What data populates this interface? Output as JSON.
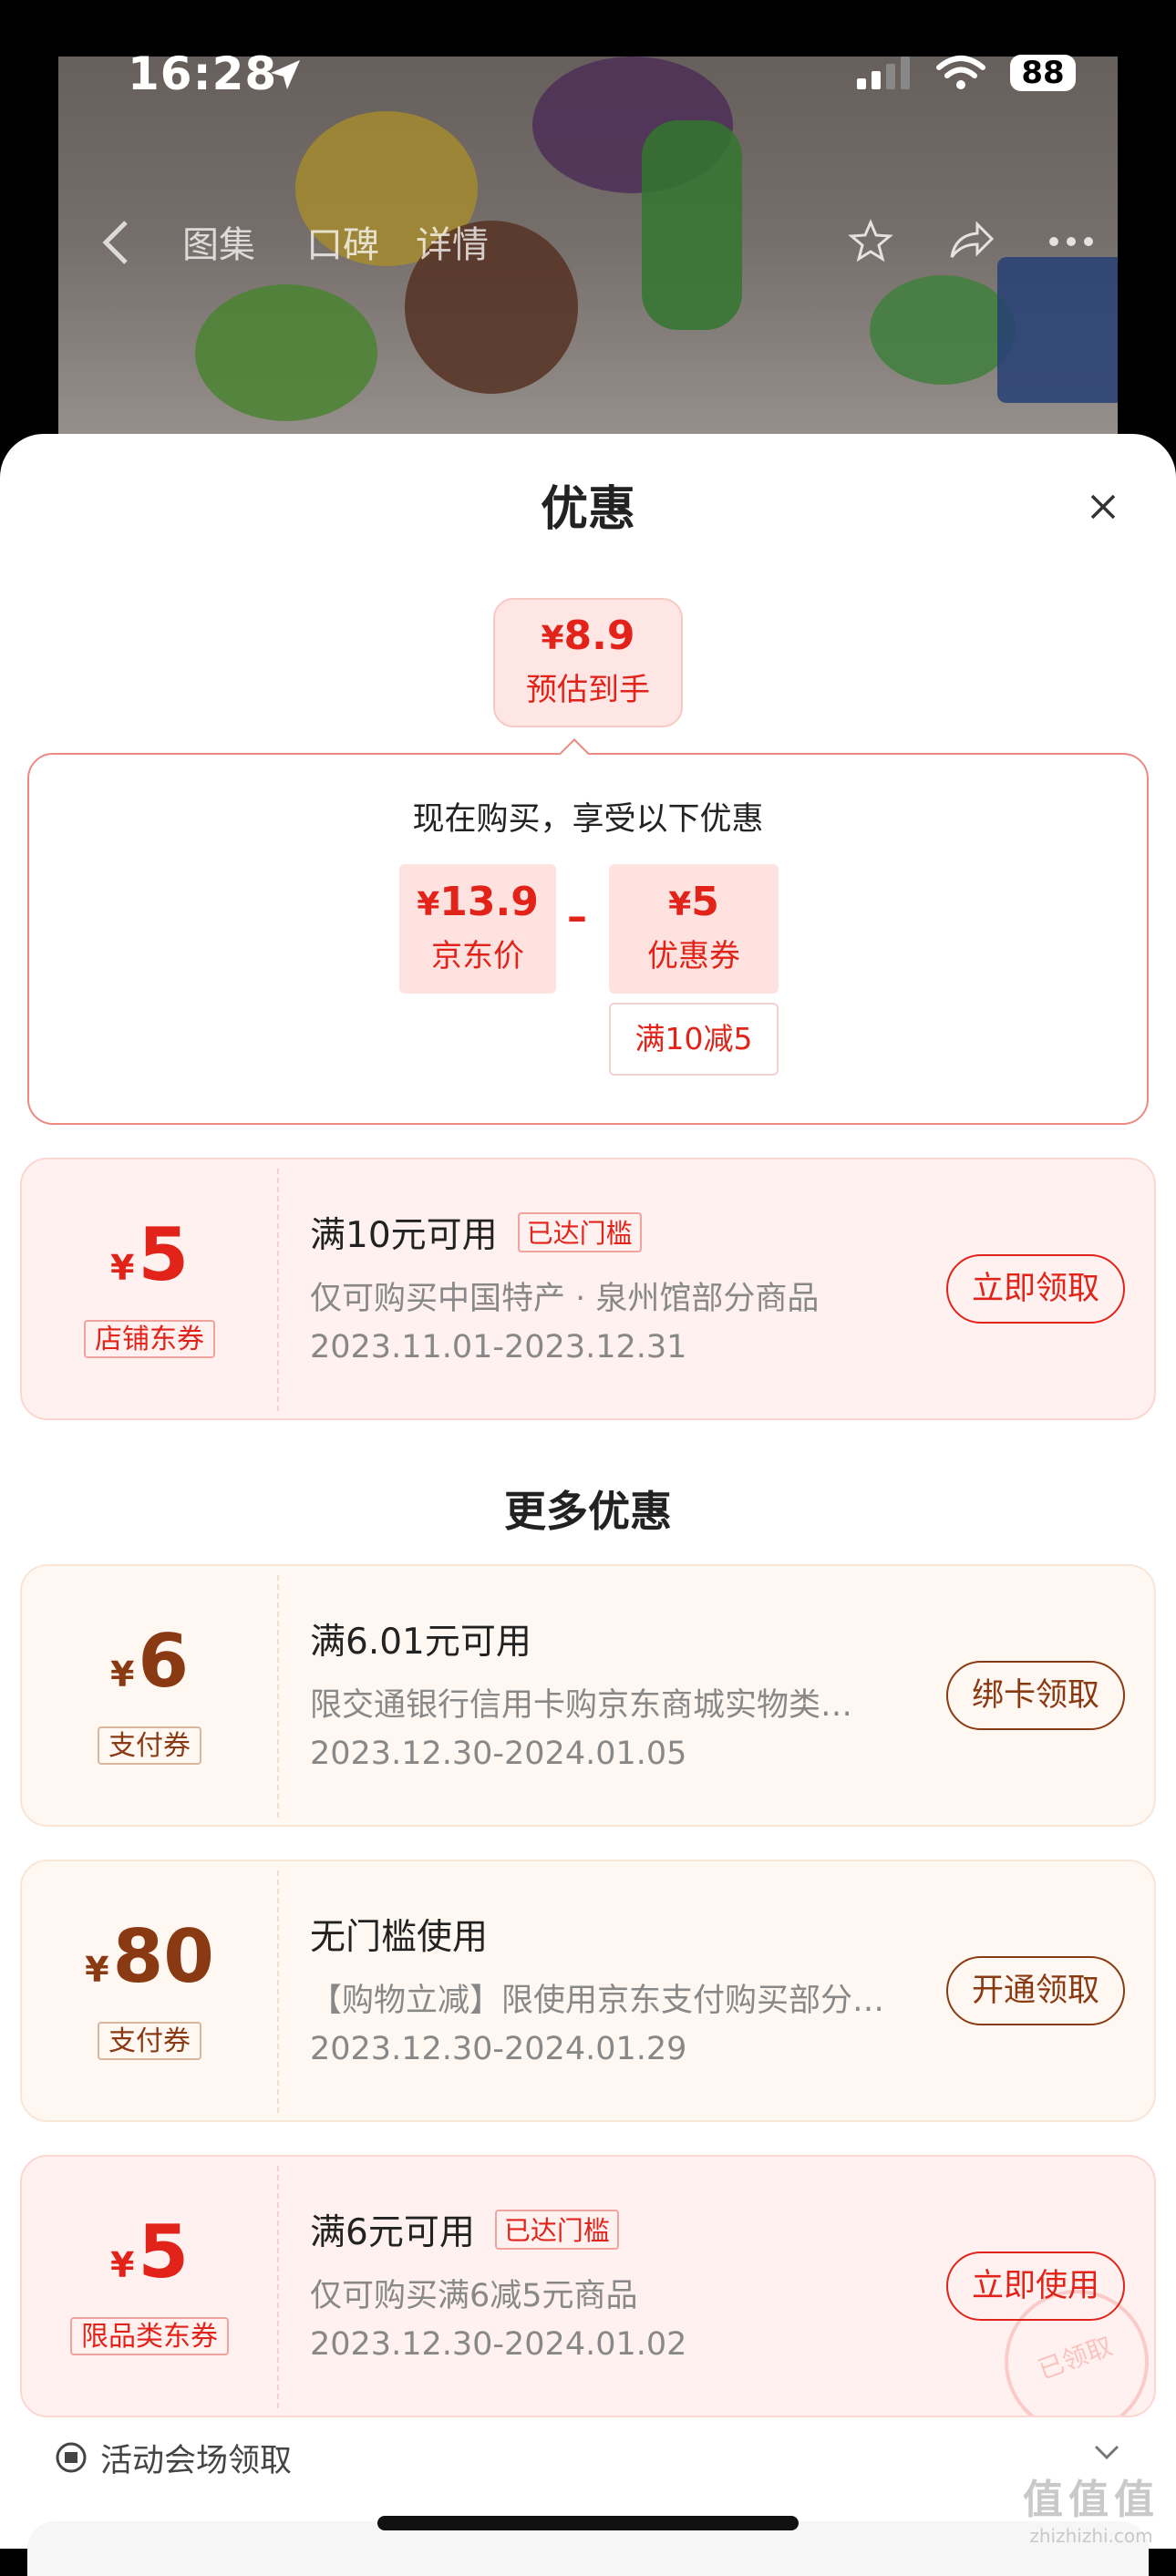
{
  "status_bar": {
    "time": "16:28",
    "battery": "88"
  },
  "nav": {
    "tabs": [
      "图集",
      "口碑",
      "详情"
    ]
  },
  "sheet": {
    "title": "优惠",
    "estimate": {
      "currency": "¥",
      "price": "8.9",
      "label": "预估到手"
    },
    "calc": {
      "title": "现在购买，享受以下优惠",
      "price_chip": {
        "currency": "¥",
        "value": "13.9",
        "label": "京东价"
      },
      "operator": "–",
      "coupon_chip": {
        "currency": "¥",
        "value": "5",
        "label": "优惠券"
      },
      "condition": "满10减5"
    },
    "more_title": "更多优惠",
    "coupons": [
      {
        "currency": "¥",
        "amount": "5",
        "tag": "店铺东券",
        "title": "满10元可用",
        "reached": "已达门槛",
        "desc": "仅可购买中国特产 · 泉州馆部分商品",
        "date": "2023.11.01-2023.12.31",
        "button": "立即领取"
      },
      {
        "currency": "¥",
        "amount": "6",
        "tag": "支付券",
        "title": "满6.01元可用",
        "desc": "限交通银行信用卡购京东商城实物类…",
        "date": "2023.12.30-2024.01.05",
        "button": "绑卡领取"
      },
      {
        "currency": "¥",
        "amount": "80",
        "tag": "支付券",
        "title": "无门槛使用",
        "desc": "【购物立减】限使用京东支付购买部分…",
        "date": "2023.12.30-2024.01.29",
        "button": "开通领取"
      },
      {
        "currency": "¥",
        "amount": "5",
        "tag": "限品类东券",
        "title": "满6元可用",
        "reached": "已达门槛",
        "desc": "仅可购买满6减5元商品",
        "date": "2023.12.30-2024.01.02",
        "button": "立即使用",
        "stamp": "已领取"
      }
    ],
    "activity": "活动会场领取"
  },
  "watermark": {
    "text": "值值值",
    "sub": "zhizhizhi.com"
  },
  "colors": {
    "accent": "#e2231a",
    "brown": "#8a3a12"
  }
}
